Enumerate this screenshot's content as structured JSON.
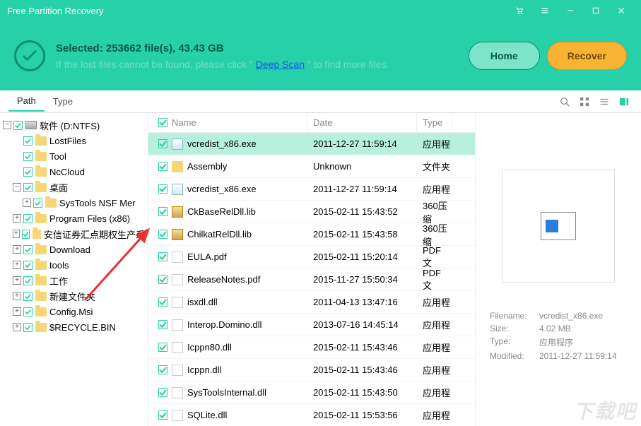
{
  "title": "Free Partition Recovery",
  "header": {
    "selected": "Selected: 253662 file(s), 43.43 GB",
    "hint_before": "If the lost files cannot be found, please click \" ",
    "hint_link": "Deep Scan",
    "hint_after": " \" to find more files.",
    "home": "Home",
    "recover": "Recover"
  },
  "tabs": {
    "path": "Path",
    "type": "Type"
  },
  "tree": [
    {
      "lvl": 0,
      "toggle": "-",
      "label": "软件 (D:NTFS)",
      "icon": "drive"
    },
    {
      "lvl": 1,
      "toggle": "",
      "label": "LostFiles",
      "icon": "folder"
    },
    {
      "lvl": 1,
      "toggle": "",
      "label": "Tool",
      "icon": "folder"
    },
    {
      "lvl": 1,
      "toggle": "",
      "label": "NcCloud",
      "icon": "folder"
    },
    {
      "lvl": 1,
      "toggle": "-",
      "label": "桌面",
      "icon": "folder"
    },
    {
      "lvl": 2,
      "toggle": "+",
      "label": "SysTools NSF Mer",
      "icon": "folder"
    },
    {
      "lvl": 1,
      "toggle": "+",
      "label": "Program Files (x86)",
      "icon": "folder"
    },
    {
      "lvl": 1,
      "toggle": "+",
      "label": "安信证券汇点期权生产系",
      "icon": "folder"
    },
    {
      "lvl": 1,
      "toggle": "+",
      "label": "Download",
      "icon": "folder"
    },
    {
      "lvl": 1,
      "toggle": "+",
      "label": "tools",
      "icon": "folder"
    },
    {
      "lvl": 1,
      "toggle": "+",
      "label": "工作",
      "icon": "folder"
    },
    {
      "lvl": 1,
      "toggle": "+",
      "label": "新建文件夹",
      "icon": "folder"
    },
    {
      "lvl": 1,
      "toggle": "+",
      "label": "Config.Msi",
      "icon": "folder"
    },
    {
      "lvl": 1,
      "toggle": "+",
      "label": "$RECYCLE.BIN",
      "icon": "folder"
    }
  ],
  "cols": {
    "name": "Name",
    "date": "Date",
    "type": "Type"
  },
  "rows": [
    {
      "name": "vcredist_x86.exe",
      "date": "2011-12-27 11:59:14",
      "type": "应用程",
      "icon": "exe",
      "sel": true
    },
    {
      "name": "Assembly",
      "date": "Unknown",
      "type": "文件夹",
      "icon": "fld"
    },
    {
      "name": "vcredist_x86.exe",
      "date": "2011-12-27 11:59:14",
      "type": "应用程",
      "icon": "exe"
    },
    {
      "name": "CkBaseRelDll.lib",
      "date": "2015-02-11 15:43:52",
      "type": "360压缩",
      "icon": "lib"
    },
    {
      "name": "ChilkatRelDll.lib",
      "date": "2015-02-11 15:43:58",
      "type": "360压缩",
      "icon": "lib"
    },
    {
      "name": "EULA.pdf",
      "date": "2015-02-11 15:20:14",
      "type": "PDF 文",
      "icon": "pdf"
    },
    {
      "name": "ReleaseNotes.pdf",
      "date": "2015-11-27 15:50:34",
      "type": "PDF 文",
      "icon": "pdf"
    },
    {
      "name": "isxdl.dll",
      "date": "2011-04-13 13:47:16",
      "type": "应用程",
      "icon": "dll"
    },
    {
      "name": "Interop.Domino.dll",
      "date": "2013-07-16 14:45:14",
      "type": "应用程",
      "icon": "dll"
    },
    {
      "name": "Icppn80.dll",
      "date": "2015-02-11 15:43:46",
      "type": "应用程",
      "icon": "dll"
    },
    {
      "name": "Icppn.dll",
      "date": "2015-02-11 15:43:46",
      "type": "应用程",
      "icon": "dll"
    },
    {
      "name": "SysToolsInternal.dll",
      "date": "2015-02-11 15:43:50",
      "type": "应用程",
      "icon": "dll"
    },
    {
      "name": "SQLite.dll",
      "date": "2015-02-11 15:53:56",
      "type": "应用程",
      "icon": "dll"
    }
  ],
  "details": {
    "labels": {
      "filename": "Filename:",
      "size": "Size:",
      "type": "Type:",
      "modified": "Modified:"
    },
    "filename": "vcredist_x86.exe",
    "size": "4.02 MB",
    "type": "应用程序",
    "modified": "2011-12-27 11:59:14"
  },
  "watermark": "下载吧"
}
